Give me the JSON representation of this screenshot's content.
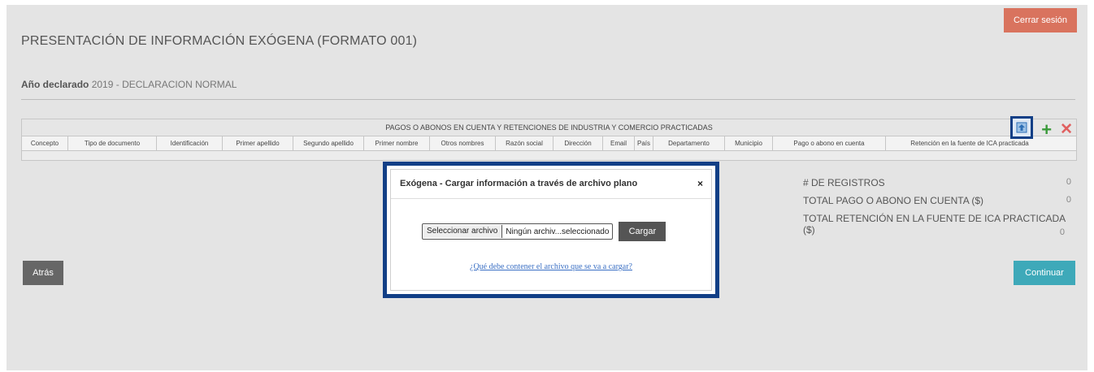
{
  "header": {
    "logout_label": "Cerrar sesión"
  },
  "page": {
    "title": "PRESENTACIÓN DE INFORMACIÓN EXÓGENA (FORMATO 001)",
    "year_label": "Año declarado",
    "year_value": "2019 - DECLARACION NORMAL"
  },
  "grid": {
    "caption": "PAGOS O ABONOS EN CUENTA Y RETENCIONES DE INDUSTRIA Y COMERCIO PRACTICADAS",
    "columns": [
      "Concepto",
      "Tipo de documento",
      "Identificación",
      "Primer apellido",
      "Segundo apellido",
      "Primer nombre",
      "Otros nombres",
      "Razón social",
      "Dirección",
      "Email",
      "País",
      "Departamento",
      "Municipio",
      "Pago o abono en cuenta",
      "Retención en la fuente de ICA practicada"
    ],
    "tools": {
      "upload_icon": "upload-file-icon",
      "add_icon": "plus-icon",
      "delete_icon": "close-icon",
      "add_glyph": "+",
      "delete_glyph": "✕"
    },
    "accent": "#123f86"
  },
  "stats": {
    "records_label": "# DE REGISTROS",
    "records_value": "0",
    "total_payment_label": "TOTAL PAGO O ABONO EN CUENTA ($)",
    "total_payment_value": "0",
    "total_retention_label": "TOTAL RETENCIÓN EN LA FUENTE DE ICA PRACTICADA ($)",
    "total_retention_value": "0"
  },
  "footer": {
    "back_label": "Atrás",
    "continue_label": "Continuar"
  },
  "modal": {
    "title": "Exógena - Cargar información a través de archivo plano",
    "close_glyph": "×",
    "file_button_label": "Seleccionar archivo",
    "file_name_text": "Ningún archiv...seleccionado",
    "load_label": "Cargar",
    "help_link": "¿Qué debe contener el archivo que se va a cargar?"
  }
}
